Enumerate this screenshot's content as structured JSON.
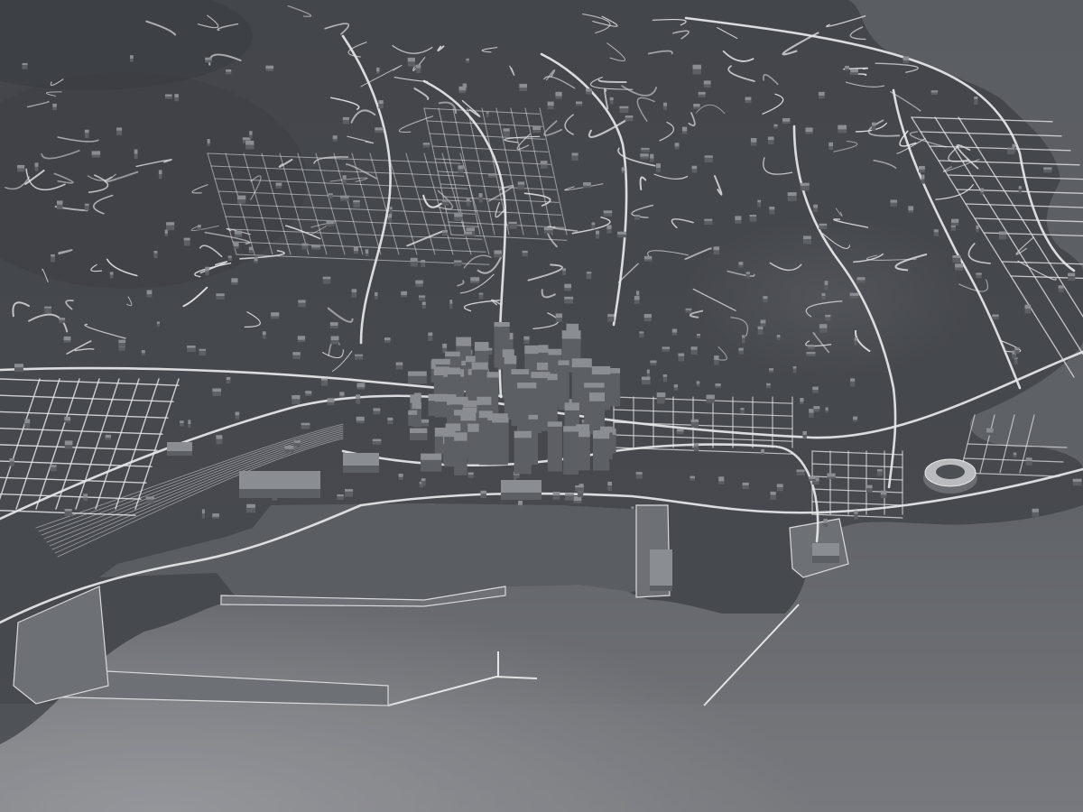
{
  "map": {
    "kind": "3d-monochrome-city-model",
    "palette": {
      "land": "#46494e",
      "land_shadow": "#3b3e43",
      "hill_highlight": "#55585d",
      "sea": "#55585e",
      "sea_light": "#8a8c90",
      "roads": "#e6e7e9",
      "buildings_top": "#8a8d92",
      "buildings_side": "#5c5f64",
      "stadium": "#b4b6b9"
    },
    "features": [
      "downtown-high-rises",
      "harbor-basin",
      "harbor-breakwater",
      "coastal-road",
      "stadium",
      "hillside-streets",
      "rail-yards"
    ]
  }
}
